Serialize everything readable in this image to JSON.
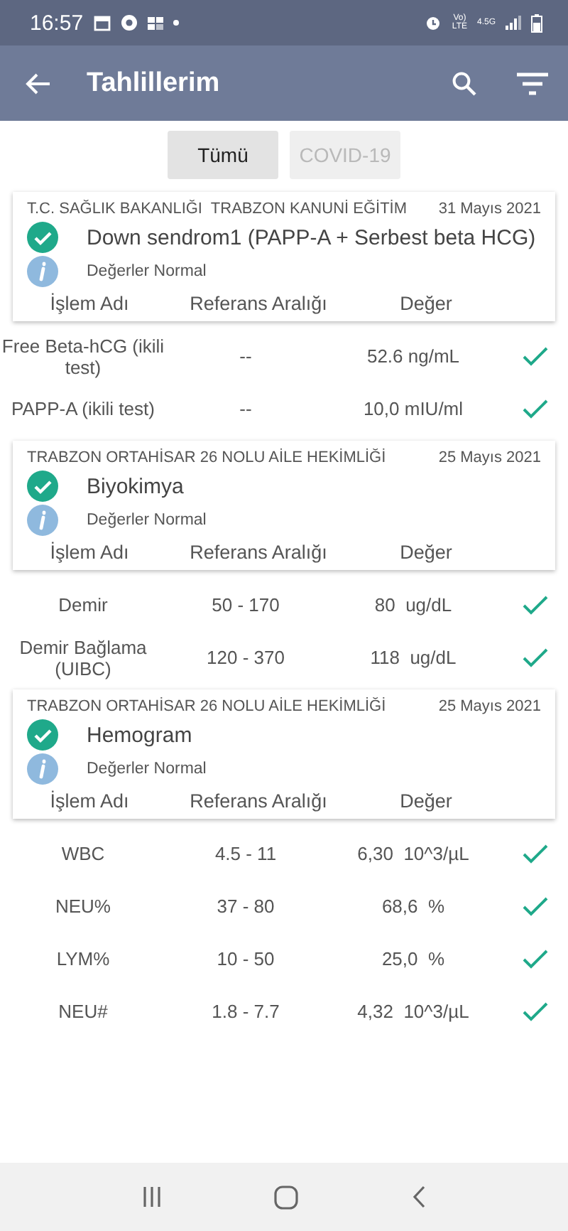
{
  "status_bar": {
    "time": "16:57",
    "volte_top": "Vo)",
    "volte_bottom": "LTE",
    "network": "4.5G"
  },
  "app_bar": {
    "title": "Tahlillerim"
  },
  "filters": [
    {
      "label": "Tümü",
      "selected": true
    },
    {
      "label": "COVID-19",
      "selected": false
    }
  ],
  "groups": [
    {
      "institution": "T.C. SAĞLIK BAKANLIĞI  TRABZON KANUNİ EĞİTİM",
      "date": "31 Mayıs 2021",
      "title": "Down sendrom1 (PAPP-A + Serbest beta HCG)",
      "normal": true,
      "status_text": "Değerler Normal",
      "columns": [
        "İşlem Adı",
        "Referans Aralığı",
        "Değer"
      ],
      "rows": [
        {
          "name": "Free Beta-hCG (ikili test)",
          "range": "--",
          "value": "52.6 ng/mL",
          "normal": true
        },
        {
          "name": "PAPP-A (ikili test)",
          "range": "--",
          "value": "10,0 mIU/ml",
          "normal": true
        }
      ]
    },
    {
      "institution": "TRABZON ORTAHİSAR 26 NOLU AİLE HEKİMLİĞİ",
      "date": "25 Mayıs 2021",
      "title": "Biyokimya",
      "normal": true,
      "status_text": "Değerler Normal",
      "columns": [
        "İşlem Adı",
        "Referans Aralığı",
        "Değer"
      ],
      "rows": [
        {
          "name": "Demir",
          "range": "50 - 170",
          "value": "80  ug/dL",
          "normal": true
        },
        {
          "name": "Demir Bağlama (UIBC)",
          "range": "120 - 370",
          "value": "118  ug/dL",
          "normal": true
        }
      ]
    },
    {
      "institution": "TRABZON ORTAHİSAR 26 NOLU AİLE HEKİMLİĞİ",
      "date": "25 Mayıs 2021",
      "title": "Hemogram",
      "normal": true,
      "status_text": "Değerler Normal",
      "columns": [
        "İşlem Adı",
        "Referans Aralığı",
        "Değer"
      ],
      "rows": [
        {
          "name": "WBC",
          "range": "4.5 - 11",
          "value": "6,30  10^3/µL",
          "normal": true
        },
        {
          "name": "NEU%",
          "range": "37 - 80",
          "value": "68,6  %",
          "normal": true
        },
        {
          "name": "LYM%",
          "range": "10 - 50",
          "value": "25,0  %",
          "normal": true
        },
        {
          "name": "NEU#",
          "range": "1.8 - 7.7",
          "value": "4,32  10^3/µL",
          "normal": true
        }
      ]
    }
  ]
}
